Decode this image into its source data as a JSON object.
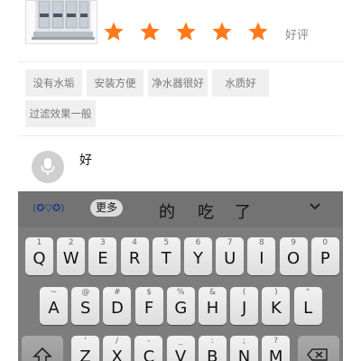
{
  "rating": {
    "stars": 5,
    "max_stars": 5,
    "label": "好评",
    "star_color": "#ff7a1a"
  },
  "tags": [
    {
      "label": "没有水垢"
    },
    {
      "label": "安装方便"
    },
    {
      "label": "净水器很好"
    },
    {
      "label": "水质好"
    },
    {
      "label": "过滤效果一般"
    }
  ],
  "review": {
    "text": "好",
    "mic_icon": "microphone-icon"
  },
  "keyboard": {
    "emoticon": "(✪▽✪)",
    "more_label": "更多",
    "candidates": [
      "的",
      "吃",
      "了"
    ],
    "rows": [
      [
        {
          "main": "Q",
          "hint": "1"
        },
        {
          "main": "W",
          "hint": "2"
        },
        {
          "main": "E",
          "hint": "3"
        },
        {
          "main": "R",
          "hint": "4"
        },
        {
          "main": "T",
          "hint": "5"
        },
        {
          "main": "Y",
          "hint": "6"
        },
        {
          "main": "U",
          "hint": "7"
        },
        {
          "main": "I",
          "hint": "8"
        },
        {
          "main": "O",
          "hint": "9"
        },
        {
          "main": "P",
          "hint": "0"
        }
      ],
      [
        {
          "main": "A",
          "hint": "~"
        },
        {
          "main": "S",
          "hint": "@"
        },
        {
          "main": "D",
          "hint": "#"
        },
        {
          "main": "F",
          "hint": "$"
        },
        {
          "main": "G",
          "hint": "%"
        },
        {
          "main": "H",
          "hint": "&"
        },
        {
          "main": "J",
          "hint": "("
        },
        {
          "main": "K",
          "hint": ")"
        },
        {
          "main": "L",
          "hint": "\""
        }
      ],
      [
        {
          "main": "Z",
          "hint": "'"
        },
        {
          "main": "X",
          "hint": "/"
        },
        {
          "main": "C",
          "hint": "-"
        },
        {
          "main": "V",
          "hint": "_"
        },
        {
          "main": "B",
          "hint": ":"
        },
        {
          "main": "N",
          "hint": ";"
        },
        {
          "main": "M",
          "hint": "?"
        }
      ]
    ],
    "shift_icon": "shift-arrow-icon",
    "backspace_icon": "backspace-icon",
    "collapse_icon": "chevron-down-icon"
  }
}
